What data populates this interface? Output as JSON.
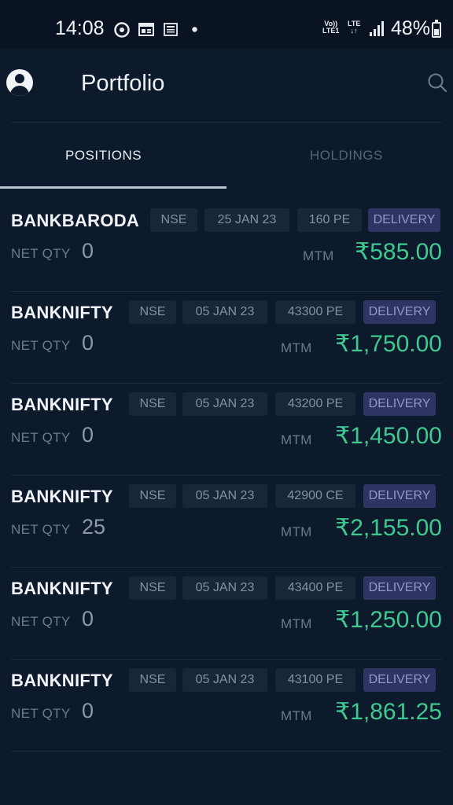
{
  "status_bar": {
    "time": "14:08",
    "icons": [
      "chrome-icon",
      "news-icon",
      "document-icon",
      "dot-icon"
    ],
    "volte_top": "Vo))",
    "volte_bottom": "LTE1",
    "lte_top": "LTE",
    "lte_bottom": "↓↑",
    "battery": "48%"
  },
  "header": {
    "title": "Portfolio",
    "profile_icon": "profile-icon",
    "search_icon": "search-icon"
  },
  "tabs": [
    {
      "label": "POSITIONS",
      "active": true
    },
    {
      "label": "HOLDINGS",
      "active": false
    }
  ],
  "labels": {
    "net_qty": "NET QTY",
    "mtm": "MTM"
  },
  "colors": {
    "background": "#0d1a2c",
    "profit": "#3fc890",
    "delivery_chip": "#2e3563"
  },
  "positions": [
    {
      "symbol": "BANKBARODA",
      "exchange": "NSE",
      "expiry": "25 JAN 23",
      "strike": "160 PE",
      "product": "DELIVERY",
      "net_qty": "0",
      "mtm": "₹585.00"
    },
    {
      "symbol": "BANKNIFTY",
      "exchange": "NSE",
      "expiry": "05 JAN 23",
      "strike": "43300 PE",
      "product": "DELIVERY",
      "net_qty": "0",
      "mtm": "₹1,750.00"
    },
    {
      "symbol": "BANKNIFTY",
      "exchange": "NSE",
      "expiry": "05 JAN 23",
      "strike": "43200 PE",
      "product": "DELIVERY",
      "net_qty": "0",
      "mtm": "₹1,450.00"
    },
    {
      "symbol": "BANKNIFTY",
      "exchange": "NSE",
      "expiry": "05 JAN 23",
      "strike": "42900 CE",
      "product": "DELIVERY",
      "net_qty": "25",
      "mtm": "₹2,155.00"
    },
    {
      "symbol": "BANKNIFTY",
      "exchange": "NSE",
      "expiry": "05 JAN 23",
      "strike": "43400 PE",
      "product": "DELIVERY",
      "net_qty": "0",
      "mtm": "₹1,250.00"
    },
    {
      "symbol": "BANKNIFTY",
      "exchange": "NSE",
      "expiry": "05 JAN 23",
      "strike": "43100 PE",
      "product": "DELIVERY",
      "net_qty": "0",
      "mtm": "₹1,861.25"
    }
  ]
}
